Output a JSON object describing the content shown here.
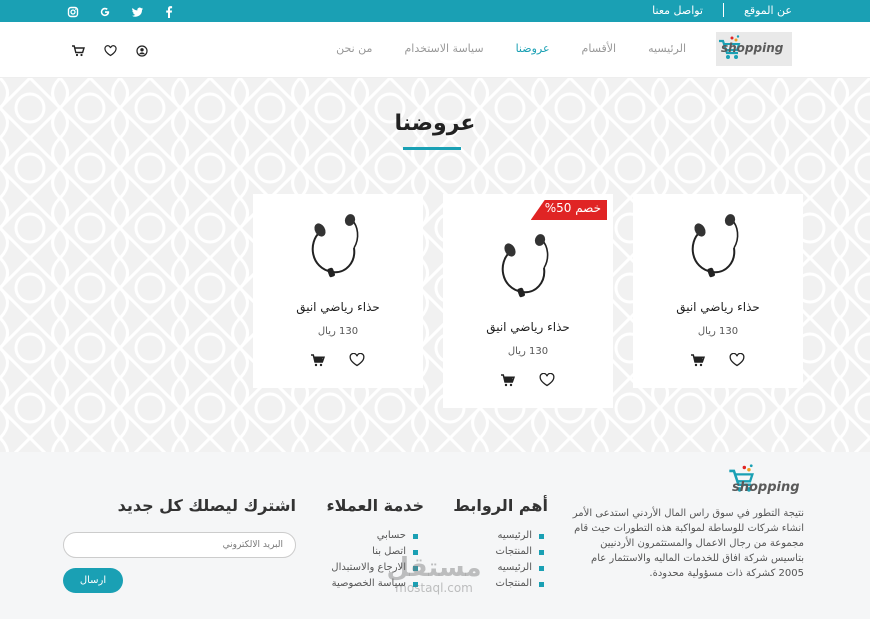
{
  "topbar": {
    "about_label": "عن الموقع",
    "contact_label": "تواصل معنا",
    "social_icons": [
      "instagram-icon",
      "google-icon",
      "twitter-icon",
      "facebook-icon"
    ]
  },
  "header": {
    "logo_text": "shopping",
    "nav": [
      {
        "label": "الرئيسيه",
        "active": false
      },
      {
        "label": "الأقسام",
        "active": false
      },
      {
        "label": "عروضنا",
        "active": true
      },
      {
        "label": "سياسة الاستخدام",
        "active": false
      },
      {
        "label": "من نحن",
        "active": false
      }
    ],
    "icons": [
      "cart-icon",
      "heart-icon",
      "user-icon"
    ]
  },
  "offers": {
    "title": "عروضنا",
    "products": [
      {
        "name": "حذاء رياضي انيق",
        "price": "130 ريال",
        "badge": "",
        "image": "earphones-image"
      },
      {
        "name": "حذاء رياضي انيق",
        "price": "130 ريال",
        "badge": "خصم 50%",
        "image": "earphones-image"
      },
      {
        "name": "حذاء رياضي انيق",
        "price": "130 ريال",
        "badge": "",
        "image": "earphones-image"
      }
    ]
  },
  "footer": {
    "logo_text": "shopping",
    "about_text": "نتيجة التطور في سوق راس المال الأردني استدعى الأمر انشاء شركات للوساطة لمواكبة هذه التطورات حيث قام مجموعة من رجال الاعمال والمستثمرون الأردنيين بتاسيس شركة افاق للخدمات الماليه والاستثمار عام 2005 كشركة ذات مسؤولية محدودة.",
    "links_title": "أهم الروابط",
    "links": [
      "الرئيسيه",
      "المنتجات",
      "الرئيسيه",
      "المنتجات"
    ],
    "service_title": "خدمة العملاء",
    "service_links": [
      "حسابي",
      "اتصل بنا",
      "الارجاع والاستبدال",
      "سياسة الخصوصية"
    ],
    "subscribe_title": "اشترك ليصلك كل جديد",
    "email_placeholder": "البريد الالكتروني",
    "send_label": "ارسال",
    "watermark_big": "مستقل",
    "watermark_small": "mostaql.com"
  },
  "colors": {
    "accent": "#1aa0b4",
    "badge": "#e02424"
  }
}
